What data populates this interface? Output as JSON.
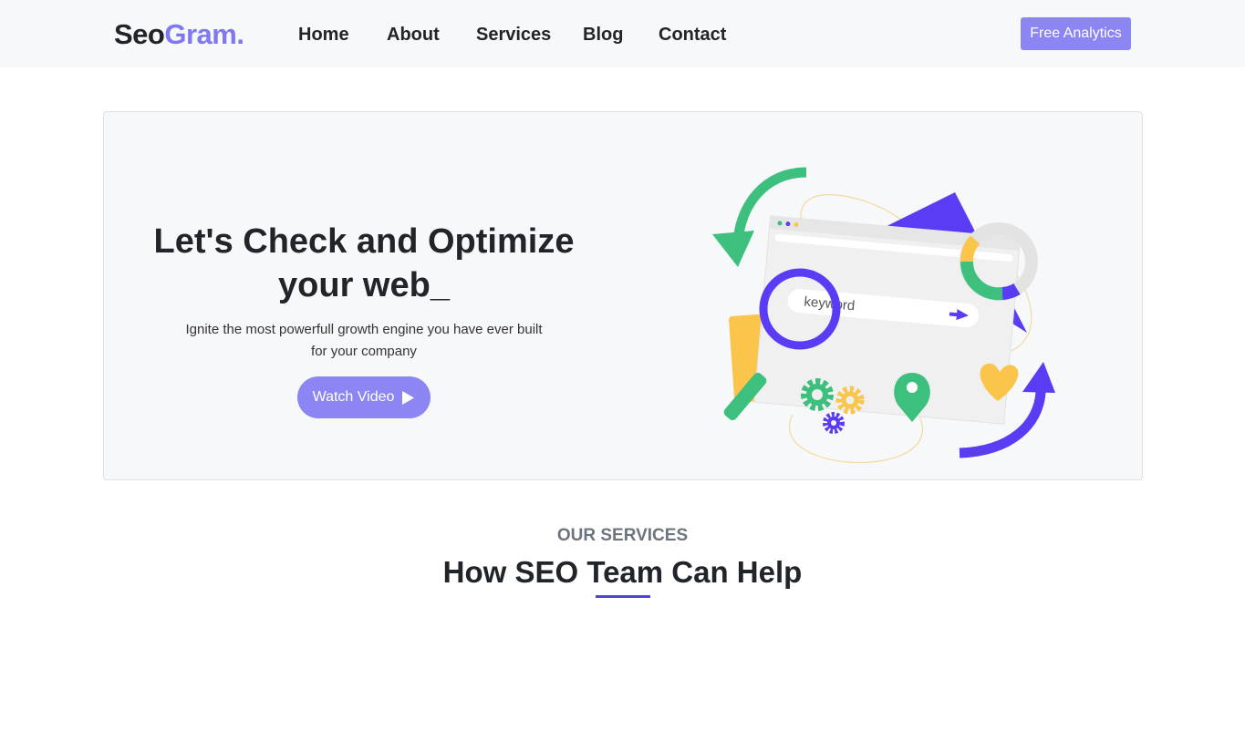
{
  "navbar": {
    "brand_part1": "Seo",
    "brand_part2": "Gram.",
    "links": [
      "Home",
      "About",
      "Services",
      "Blog",
      "Contact"
    ],
    "cta_label": "Free Analytics"
  },
  "hero": {
    "title": "Let's Check and Optimize your web_",
    "subtitle": "Ignite the most powerfull growth engine you have ever built for your company",
    "button_label": "Watch Video",
    "illustration_search_text": "keyword"
  },
  "services": {
    "kicker": "OUR SERVICES",
    "title": "How SEO Team Can Help"
  },
  "colors": {
    "accent": "#8c85f4",
    "brand_purple": "#7f78ee",
    "green": "#3dbf7d",
    "yellow": "#fbc44a",
    "deep_purple": "#5b3cf5"
  }
}
